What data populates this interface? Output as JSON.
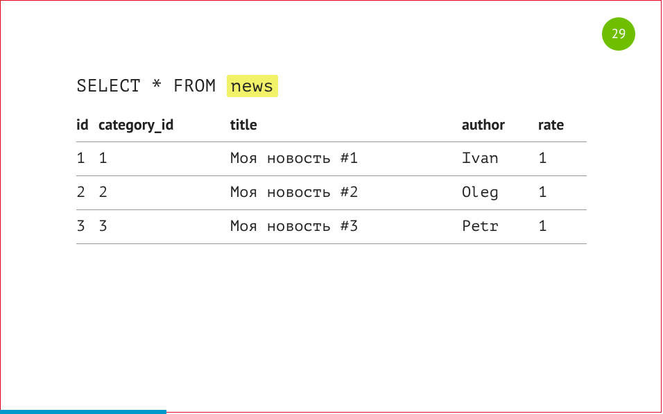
{
  "page_number": "29",
  "query": {
    "prefix": "SELECT * FROM ",
    "highlight": "news"
  },
  "table": {
    "headers": {
      "id": "id",
      "category_id": "category_id",
      "title": "title",
      "author": "author",
      "rate": "rate"
    },
    "rows": [
      {
        "id": "1",
        "category_id": "1",
        "title": "Моя новость #1",
        "author": "Ivan",
        "rate": "1"
      },
      {
        "id": "2",
        "category_id": "2",
        "title": "Моя новость #2",
        "author": "Oleg",
        "rate": "1"
      },
      {
        "id": "3",
        "category_id": "3",
        "title": "Моя новость #3",
        "author": "Petr",
        "rate": "1"
      }
    ]
  },
  "progress_color": "#0099cc"
}
